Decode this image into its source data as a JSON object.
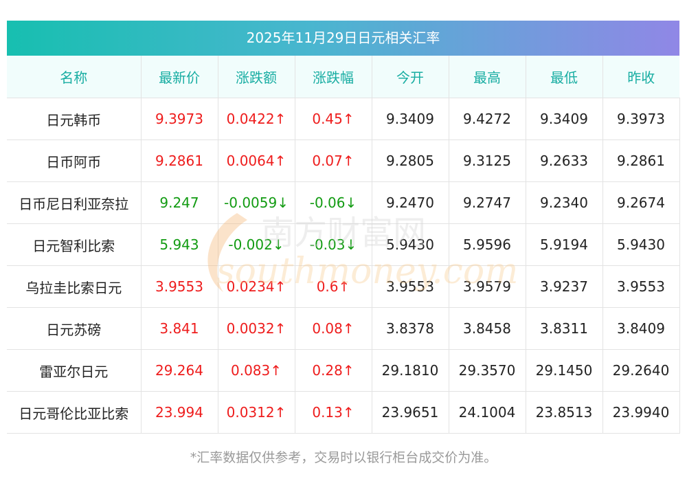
{
  "title": "2025年11月29日日元相关汇率",
  "headers": [
    "名称",
    "最新价",
    "涨跌额",
    "涨跌幅",
    "今开",
    "最高",
    "最低",
    "昨收"
  ],
  "rows": [
    {
      "name": "日元韩币",
      "latest": "9.3973",
      "change": "0.0422↑",
      "pct": "0.45↑",
      "open": "9.3409",
      "high": "9.4272",
      "low": "9.3409",
      "prev": "9.3973",
      "dir": "up"
    },
    {
      "name": "日币阿币",
      "latest": "9.2861",
      "change": "0.0064↑",
      "pct": "0.07↑",
      "open": "9.2805",
      "high": "9.3125",
      "low": "9.2633",
      "prev": "9.2861",
      "dir": "up"
    },
    {
      "name": "日币尼日利亚奈拉",
      "latest": "9.247",
      "change": "-0.0059↓",
      "pct": "-0.06↓",
      "open": "9.2470",
      "high": "9.2747",
      "low": "9.2340",
      "prev": "9.2674",
      "dir": "down"
    },
    {
      "name": "日元智利比索",
      "latest": "5.943",
      "change": "-0.002↓",
      "pct": "-0.03↓",
      "open": "5.9430",
      "high": "5.9596",
      "low": "5.9194",
      "prev": "5.9430",
      "dir": "down"
    },
    {
      "name": "乌拉圭比索日元",
      "latest": "3.9553",
      "change": "0.0234↑",
      "pct": "0.6↑",
      "open": "3.9553",
      "high": "3.9579",
      "low": "3.9237",
      "prev": "3.9553",
      "dir": "up"
    },
    {
      "name": "日元苏磅",
      "latest": "3.841",
      "change": "0.0032↑",
      "pct": "0.08↑",
      "open": "3.8378",
      "high": "3.8458",
      "low": "3.8311",
      "prev": "3.8409",
      "dir": "up"
    },
    {
      "name": "雷亚尔日元",
      "latest": "29.264",
      "change": "0.083↑",
      "pct": "0.28↑",
      "open": "29.1810",
      "high": "29.3570",
      "low": "29.1450",
      "prev": "29.2640",
      "dir": "up"
    },
    {
      "name": "日元哥伦比亚比索",
      "latest": "23.994",
      "change": "0.0312↑",
      "pct": "0.13↑",
      "open": "23.9651",
      "high": "24.1004",
      "low": "23.8513",
      "prev": "23.9940",
      "dir": "up"
    }
  ],
  "watermark": {
    "cn": "南方财富网",
    "en": "southmoney.com"
  },
  "footnote": "*汇率数据仅供参考，交易时以银行柜台成交价为准。",
  "colors": {
    "up": "#ee1c1c",
    "down": "#129b12",
    "header_text": "#18ada2",
    "title_start": "#17bfb0",
    "title_end": "#9087e6"
  }
}
